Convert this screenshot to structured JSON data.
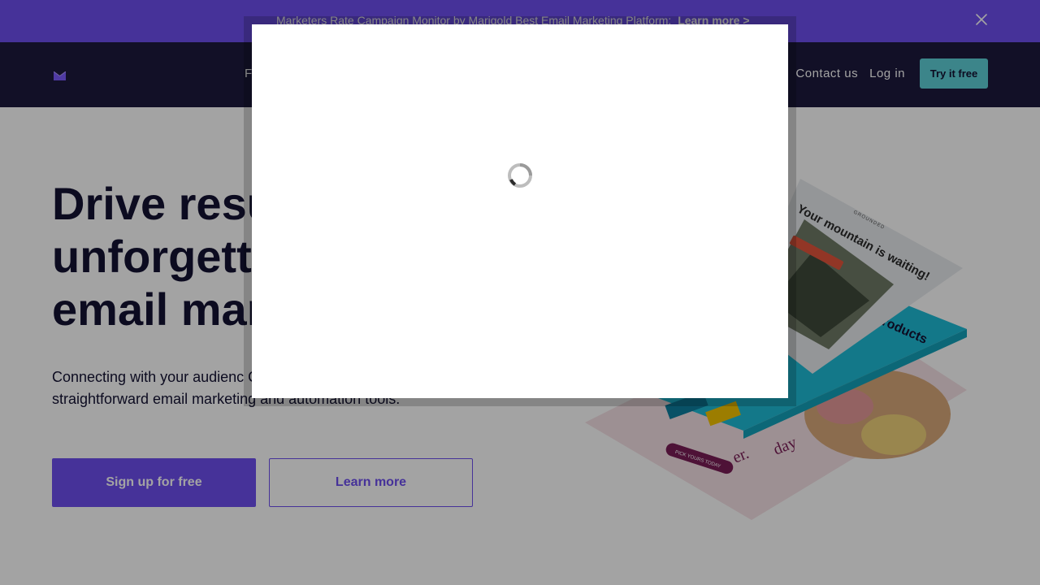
{
  "banner": {
    "text": "Marketers Rate Campaign Monitor by Marigold Best Email Marketing Platform:",
    "link": "Learn more >"
  },
  "nav": {
    "left_partial": "F",
    "contact": "Contact us",
    "login": "Log in",
    "try": "Try it free"
  },
  "hero": {
    "title_lines": [
      "Drive resu",
      "unforgett",
      "email mar"
    ],
    "subtitle": "Connecting with your audienc Campaign Monitor’s straightforward email marketing and automation tools.",
    "primary_cta": "Sign up for free",
    "secondary_cta": "Learn more"
  },
  "illustration": {
    "heading": "Your mountain is waiting!",
    "brand": "GROUNDED",
    "products": "Products",
    "day_text": "day",
    "er_text": "er.",
    "badge": "PICK YOURS TODAY"
  },
  "colors": {
    "brand": "#6e4ff0",
    "navy": "#1d1a3d",
    "teal": "#5ed1d8"
  }
}
